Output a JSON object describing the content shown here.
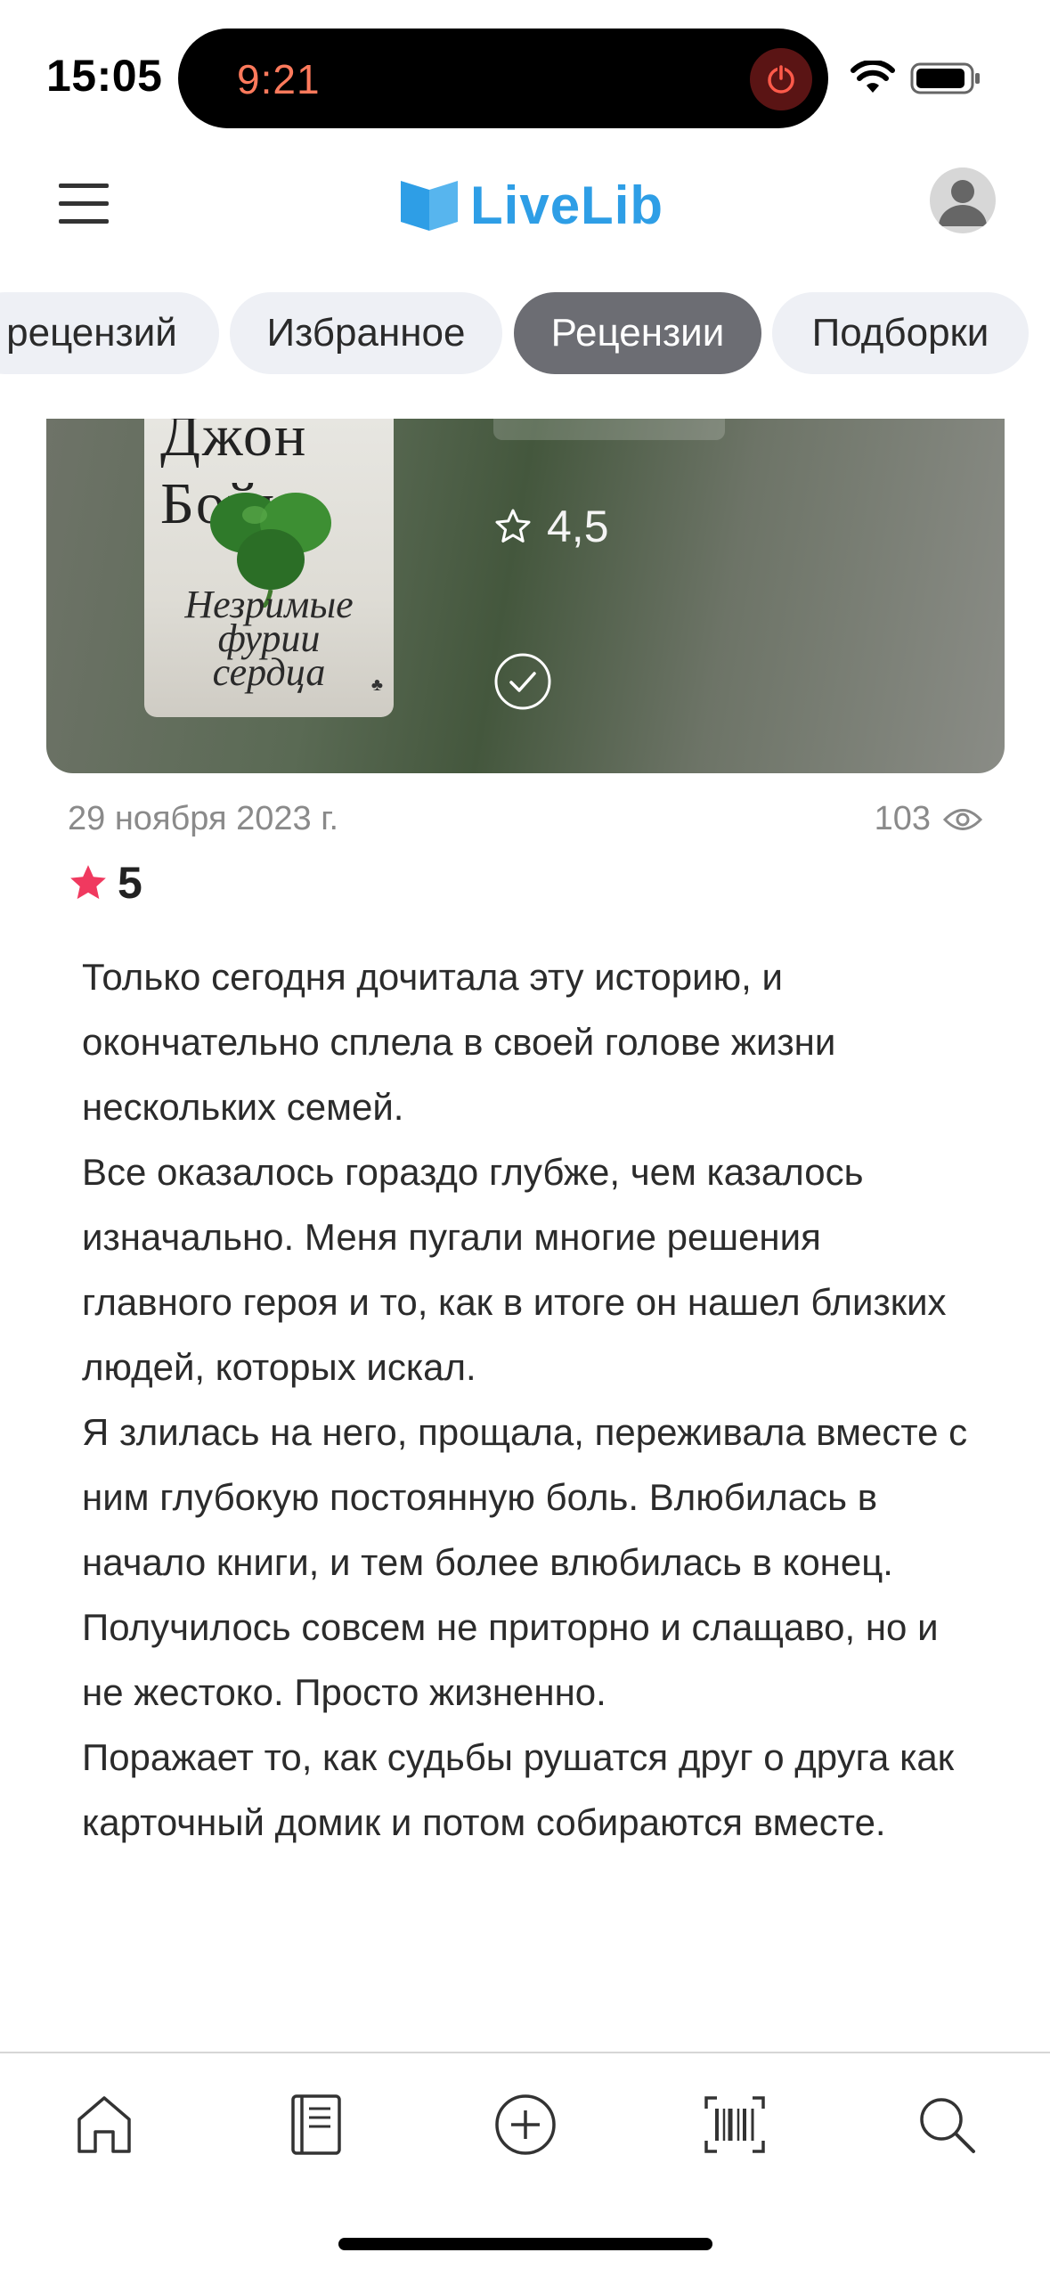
{
  "status_bar": {
    "time": "15:05",
    "island_timer": "9:21",
    "icons": [
      "stop-icon",
      "wifi-icon",
      "battery-icon"
    ]
  },
  "header": {
    "logo_text": "LiveLib",
    "icons": [
      "menu-icon",
      "logo-book-icon",
      "avatar-icon"
    ],
    "accent_color": "#2e9ee6"
  },
  "tabs": [
    {
      "label": "рецензий",
      "active": false
    },
    {
      "label": "Избранное",
      "active": false
    },
    {
      "label": "Рецензии",
      "active": true
    },
    {
      "label": "Подборки",
      "active": false
    }
  ],
  "book_card": {
    "cover_author": "Джон Бойн",
    "cover_title": "Незримые фурии сердца",
    "rating": "4,5",
    "icons": [
      "star-outline-icon",
      "check-circle-icon"
    ]
  },
  "review": {
    "date": "29 ноября 2023 г.",
    "views": "103",
    "rating": "5",
    "star_color": "#f0395f",
    "paragraphs": [
      "Только сегодня дочитала эту историю, и окончательно сплела в своей голове жизни нескольких семей.",
      "Все оказалось гораздо глубже, чем казалось изначально. Меня пугали многие решения главного героя и то, как в итоге он нашел близких людей, которых искал.",
      "Я злилась на него, прощала, переживала вместе с ним глубокую постоянную боль. Влюбилась в начало книги, и тем более влюбилась в конец. Получилось совсем не приторно и слащаво, но и не жестоко. Просто жизненно.",
      "Поражает то, как судьбы рушатся друг о друга как карточный домик и потом собираются вместе."
    ]
  },
  "bottom_nav": {
    "items": [
      "home-icon",
      "notebook-icon",
      "add-circle-icon",
      "barcode-icon",
      "search-icon"
    ]
  }
}
